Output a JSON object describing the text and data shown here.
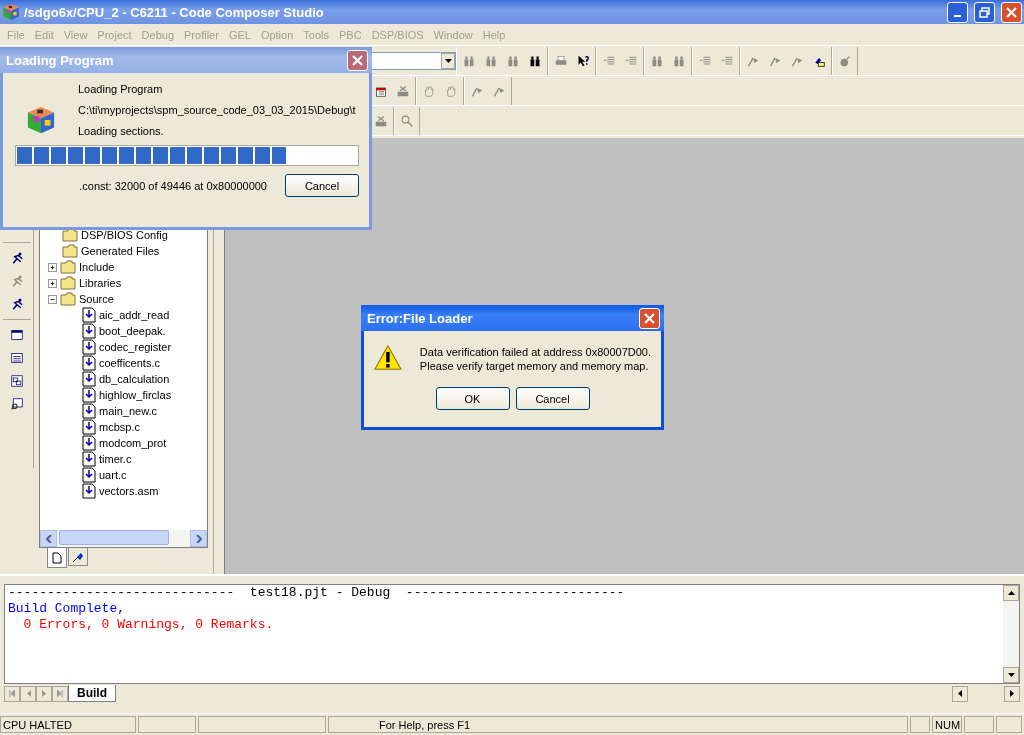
{
  "window": {
    "title": "/sdgo6x/CPU_2 - C6211 - Code Composer Studio"
  },
  "menu": [
    {
      "label": "File",
      "disabled": true
    },
    {
      "label": "Edit",
      "disabled": true
    },
    {
      "label": "View",
      "disabled": true
    },
    {
      "label": "Project",
      "disabled": true
    },
    {
      "label": "Debug",
      "disabled": true
    },
    {
      "label": "Profiler",
      "disabled": true
    },
    {
      "label": "GEL",
      "disabled": true
    },
    {
      "label": "Option",
      "disabled": true
    },
    {
      "label": "Tools",
      "disabled": true
    },
    {
      "label": "PBC",
      "disabled": true
    },
    {
      "label": "DSP/BIOS",
      "disabled": true
    },
    {
      "label": "Window",
      "disabled": true
    },
    {
      "label": "Help",
      "disabled": true
    }
  ],
  "project_tree": {
    "items": [
      {
        "label": "DSP/BIOS Config",
        "kind": "folder"
      },
      {
        "label": "Generated Files",
        "kind": "folder"
      },
      {
        "label": "Include",
        "kind": "folder",
        "expanded": false
      },
      {
        "label": "Libraries",
        "kind": "folder",
        "expanded": false
      },
      {
        "label": "Source",
        "kind": "folder",
        "expanded": true,
        "children": [
          {
            "label": "aic_addr_read",
            "kind": "file"
          },
          {
            "label": "boot_deepak.",
            "kind": "file"
          },
          {
            "label": "codec_register",
            "kind": "file"
          },
          {
            "label": "coefficents.c",
            "kind": "file"
          },
          {
            "label": "db_calculation",
            "kind": "file"
          },
          {
            "label": "highlow_firclas",
            "kind": "file"
          },
          {
            "label": "main_new.c",
            "kind": "file"
          },
          {
            "label": "mcbsp.c",
            "kind": "file"
          },
          {
            "label": "modcom_prot",
            "kind": "file"
          },
          {
            "label": "timer.c",
            "kind": "file"
          },
          {
            "label": "uart.c",
            "kind": "file"
          },
          {
            "label": "vectors.asm",
            "kind": "file"
          }
        ]
      }
    ]
  },
  "tree_tabs": [
    {
      "kind": "files",
      "selected": true
    },
    {
      "kind": "bookmarks",
      "selected": false
    }
  ],
  "output": {
    "lines": [
      {
        "kind": "header",
        "text": "-----------------------------  test18.pjt - Debug  ----------------------------"
      },
      {
        "kind": "info",
        "text": "Build Complete,"
      },
      {
        "kind": "error",
        "text": "  0 Errors, 0 Warnings, 0 Remarks."
      }
    ],
    "tabs": [
      {
        "label": "Build",
        "selected": true
      }
    ]
  },
  "status_bar": {
    "state": "CPU HALTED",
    "help": "For Help, press F1",
    "num_lock": "NUM"
  },
  "loading_dialog": {
    "title": "Loading Program",
    "heading": "Loading Program",
    "path": "C:\\ti\\myprojects\\spm_source_code_03_03_2015\\Debug\\t",
    "status": "Loading sections.",
    "level": 0.79,
    "detail": ".const: 32000 of 49446 at 0x80000000",
    "button": "Cancel"
  },
  "error_dialog": {
    "title": "Error:File Loader",
    "message": [
      "Data verification failed at address 0x80007D00.",
      "Please verify target memory and memory map."
    ],
    "buttons": [
      "OK",
      "Cancel"
    ]
  }
}
